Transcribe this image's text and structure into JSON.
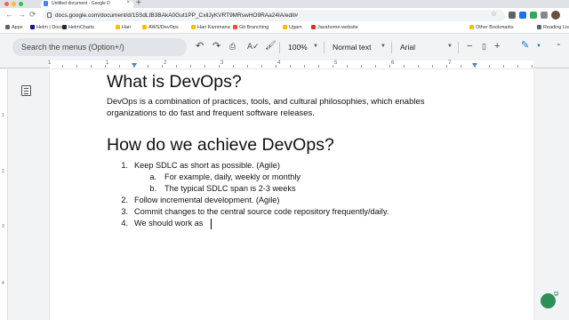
{
  "browser": {
    "tab_title": "Untitled document - Google D",
    "tab_close": "×",
    "new_tab": "+",
    "url": "docs.google.com/document/d/15SdLtB3BAkA0Gut1PP_CxilJyKVRT9MRswHO9RAa24IA/edit#",
    "bookmarks": [
      {
        "label": "Apps",
        "color": "#5f6368"
      },
      {
        "label": "Helm | Docs",
        "color": "#0f1689"
      },
      {
        "label": "HelmCharts",
        "color": "#24292e"
      },
      {
        "label": "Hari",
        "color": "#fbbc04"
      },
      {
        "label": "AWS/DevOps",
        "color": "#fbbc04"
      },
      {
        "label": "Hari Kammana",
        "color": "#fbbc04"
      },
      {
        "label": "Git Branching",
        "color": "#f05033"
      },
      {
        "label": "Ugam",
        "color": "#fbbc04"
      },
      {
        "label": "Javahome-website",
        "color": "#d93025"
      },
      {
        "label": "Other Bookmarks",
        "color": "#fbbc04"
      },
      {
        "label": "Reading List",
        "color": "#5f6368"
      }
    ]
  },
  "toolbar": {
    "search_placeholder": "Search the menus (Option+/)",
    "zoom": "100%",
    "style": "Normal text",
    "font": "Arial"
  },
  "ruler": {
    "h_numbers": [
      "1",
      "1",
      "2",
      "3",
      "4",
      "5",
      "6",
      "7"
    ],
    "v_numbers": [
      "1",
      "2",
      "3",
      "4"
    ]
  },
  "document": {
    "heading1": "What is DevOps?",
    "paragraph": [
      "DevOps is a combination of practices, tools, and cultural philosophies, which enables",
      "organizations to do fast and frequent software releases."
    ],
    "heading2": "How do we achieve DevOps?",
    "list": [
      {
        "marker": "1.",
        "text": "Keep SDLC as short as possible. (Agile)"
      },
      {
        "marker": "a.",
        "text": "For example, daily, weekly or monthly"
      },
      {
        "marker": "b.",
        "text": "The typical SDLC span is 2-3 weeks"
      },
      {
        "marker": "2.",
        "text": "Follow incremental development. (Agile)"
      },
      {
        "marker": "3.",
        "text": "Commit changes to the central source code repository frequently/daily."
      },
      {
        "marker": "4.",
        "text": "We should work as"
      }
    ]
  },
  "explore_badge": "2"
}
